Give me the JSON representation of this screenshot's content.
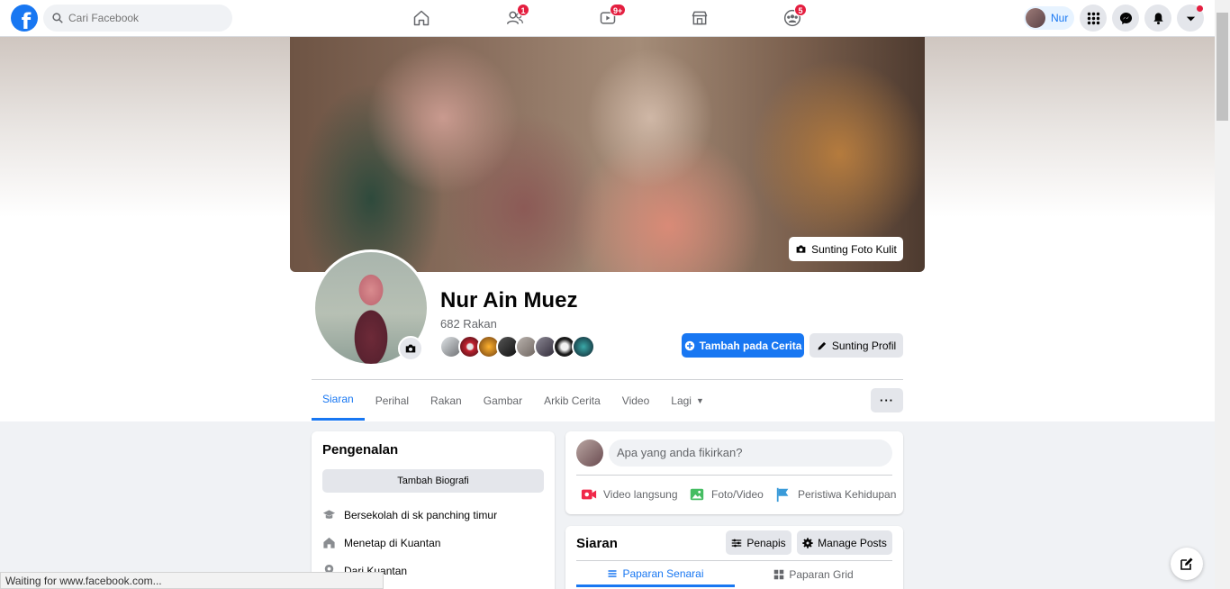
{
  "nav": {
    "search_placeholder": "Cari Facebook",
    "logo_letter": "f",
    "friends_badge": "1",
    "watch_badge": "9+",
    "groups_badge": "5",
    "profile_name": "Nur",
    "accent": "#1877f2",
    "badge_color": "#e41e3f"
  },
  "cover": {
    "edit_button": "Sunting Foto Kulit"
  },
  "profile": {
    "name": "Nur Ain Muez",
    "friend_count": "682 Rakan",
    "add_story_button": "Tambah pada Cerita",
    "edit_profile_button": "Sunting Profil"
  },
  "tabs": [
    {
      "label": "Siaran",
      "active": true
    },
    {
      "label": "Perihal"
    },
    {
      "label": "Rakan"
    },
    {
      "label": "Gambar"
    },
    {
      "label": "Arkib Cerita"
    },
    {
      "label": "Video"
    },
    {
      "label": "Lagi"
    }
  ],
  "more_button": "···",
  "intro": {
    "title": "Pengenalan",
    "add_bio_button": "Tambah Biografi",
    "items": [
      {
        "icon": "school-icon",
        "text": "Bersekolah di sk panching timur"
      },
      {
        "icon": "home-icon",
        "text": "Menetap di Kuantan"
      },
      {
        "icon": "location-pin-icon",
        "text": "Dari Kuantan"
      }
    ]
  },
  "composer": {
    "placeholder": "Apa yang anda fikirkan?",
    "actions": [
      "Video langsung",
      "Foto/Video",
      "Peristiwa Kehidupan"
    ]
  },
  "posts": {
    "title": "Siaran",
    "filter_button": "Penapis",
    "manage_button": "Manage Posts",
    "list_view": "Paparan Senarai",
    "grid_view": "Paparan Grid"
  },
  "status_bar": "Waiting for www.facebook.com..."
}
